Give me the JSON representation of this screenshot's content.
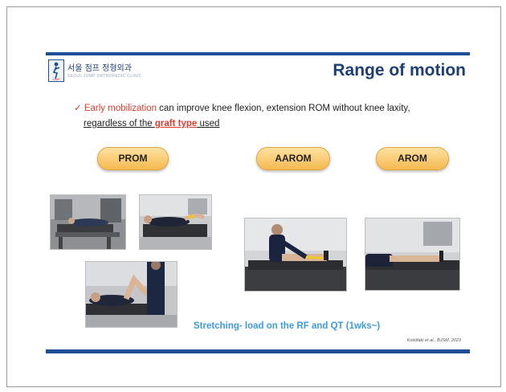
{
  "header": {
    "clinic_name": "서울 점프 정형외과",
    "clinic_sub": "SEOUL JUMP ORTHOPEDIC CLINIC",
    "logo_text": "JUMP",
    "title": "Range of motion"
  },
  "bullet": {
    "check": "✓",
    "part1": "Early mobilization",
    "part2": " can improve knee flexion, extension ROM without knee laxity,",
    "part3_start": "regardless of the ",
    "part3_red": "graft type",
    "part3_end": " used"
  },
  "buttons": [
    "PROM",
    "AAROM",
    "AROM"
  ],
  "caption": "Stretching- load on the RF and QT (1wks~)",
  "citation": "Kotsifaki et al., BJSM, 2023",
  "colors": {
    "accent": "#1e4f96",
    "highlight": "#e23b2e",
    "caption": "#3d9be0",
    "pill": "#f5b94f"
  }
}
